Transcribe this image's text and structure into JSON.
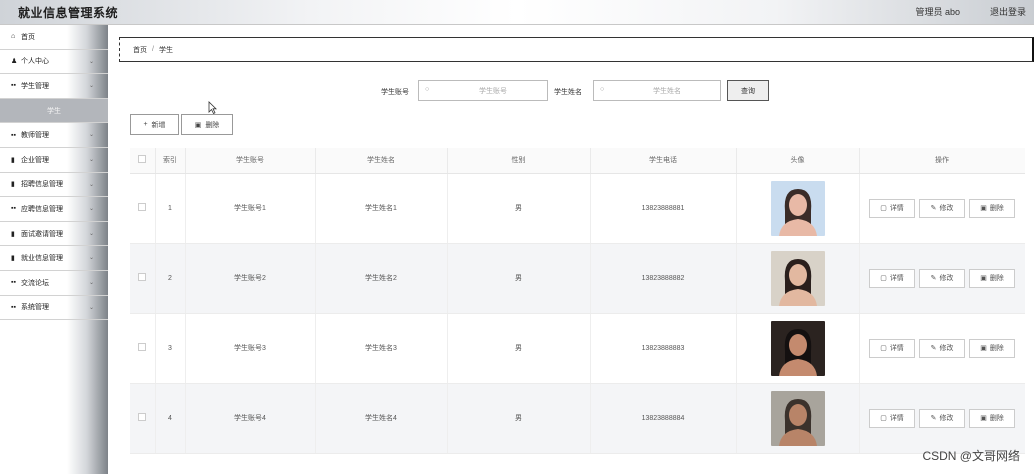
{
  "app": {
    "title": "就业信息管理系统",
    "admin_info": "管理员 abo",
    "logout": "退出登录"
  },
  "sidebar": {
    "items": [
      {
        "label": "首页",
        "icon": "home-icon",
        "glyph": "⌂"
      },
      {
        "label": "个人中心",
        "icon": "user-icon",
        "glyph": "♟"
      },
      {
        "label": "学生管理",
        "icon": "grid-icon",
        "glyph": "▪▪"
      },
      {
        "label": "学生",
        "sub": true
      },
      {
        "label": "教师管理",
        "icon": "grid-icon",
        "glyph": "▪▪"
      },
      {
        "label": "企业管理",
        "icon": "doc-icon",
        "glyph": "▮"
      },
      {
        "label": "招聘信息管理",
        "icon": "doc-icon",
        "glyph": "▮"
      },
      {
        "label": "应聘信息管理",
        "icon": "grid-icon",
        "glyph": "▪▪"
      },
      {
        "label": "面试邀请管理",
        "icon": "doc-icon",
        "glyph": "▮"
      },
      {
        "label": "就业信息管理",
        "icon": "doc-icon",
        "glyph": "▮"
      },
      {
        "label": "交流论坛",
        "icon": "grid-icon",
        "glyph": "▪▪"
      },
      {
        "label": "系统管理",
        "icon": "grid-icon",
        "glyph": "▪▪"
      }
    ]
  },
  "breadcrumb": {
    "home": "首页",
    "separator": "/",
    "current": "学生"
  },
  "search": {
    "account_label": "学生账号",
    "account_placeholder": "学生账号",
    "name_label": "学生姓名",
    "name_placeholder": "学生姓名",
    "query_label": "查询"
  },
  "actions": {
    "add_label": "新增",
    "delete_label": "删除"
  },
  "table": {
    "headers": [
      "索引",
      "学生账号",
      "学生姓名",
      "性别",
      "学生电话",
      "头像",
      "操作"
    ],
    "rows": [
      {
        "index": "1",
        "account": "学生账号1",
        "name": "学生姓名1",
        "gender": "男",
        "phone": "13823888881",
        "avatar_colors": [
          "#c9dcef",
          "#e8b9a6",
          "#3a2c28"
        ]
      },
      {
        "index": "2",
        "account": "学生账号2",
        "name": "学生姓名2",
        "gender": "男",
        "phone": "13823888882",
        "avatar_colors": [
          "#d8d2c8",
          "#e2b8a0",
          "#2a1f1c"
        ]
      },
      {
        "index": "3",
        "account": "学生账号3",
        "name": "学生姓名3",
        "gender": "男",
        "phone": "13823888883",
        "avatar_colors": [
          "#2b2320",
          "#c48a6e",
          "#141010"
        ]
      },
      {
        "index": "4",
        "account": "学生账号4",
        "name": "学生姓名4",
        "gender": "男",
        "phone": "13823888884",
        "avatar_colors": [
          "#a8a49c",
          "#b88468",
          "#3b322c"
        ]
      }
    ],
    "row_actions": {
      "detail": "详情",
      "edit": "修改",
      "delete": "删除"
    }
  },
  "watermark": "CSDN @文哥网络"
}
